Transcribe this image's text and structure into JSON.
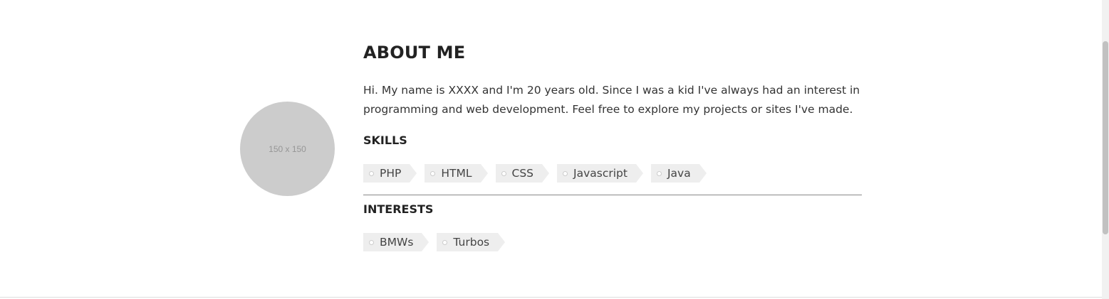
{
  "avatar": {
    "placeholder_text": "150 x 150"
  },
  "about": {
    "title": "ABOUT ME",
    "intro": "Hi. My name is XXXX and I'm 20 years old. Since I was a kid I've always had an interest in programming and web development. Feel free to explore my projects or sites I've made."
  },
  "skills": {
    "heading": "SKILLS",
    "items": [
      "PHP",
      "HTML",
      "CSS",
      "Javascript",
      "Java"
    ]
  },
  "interests": {
    "heading": "INTERESTS",
    "items": [
      "BMWs",
      "Turbos"
    ]
  },
  "colors": {
    "background": "#ffffff",
    "avatar": "#cccccc",
    "tag_background": "#eeeeee",
    "divider": "#888888"
  }
}
